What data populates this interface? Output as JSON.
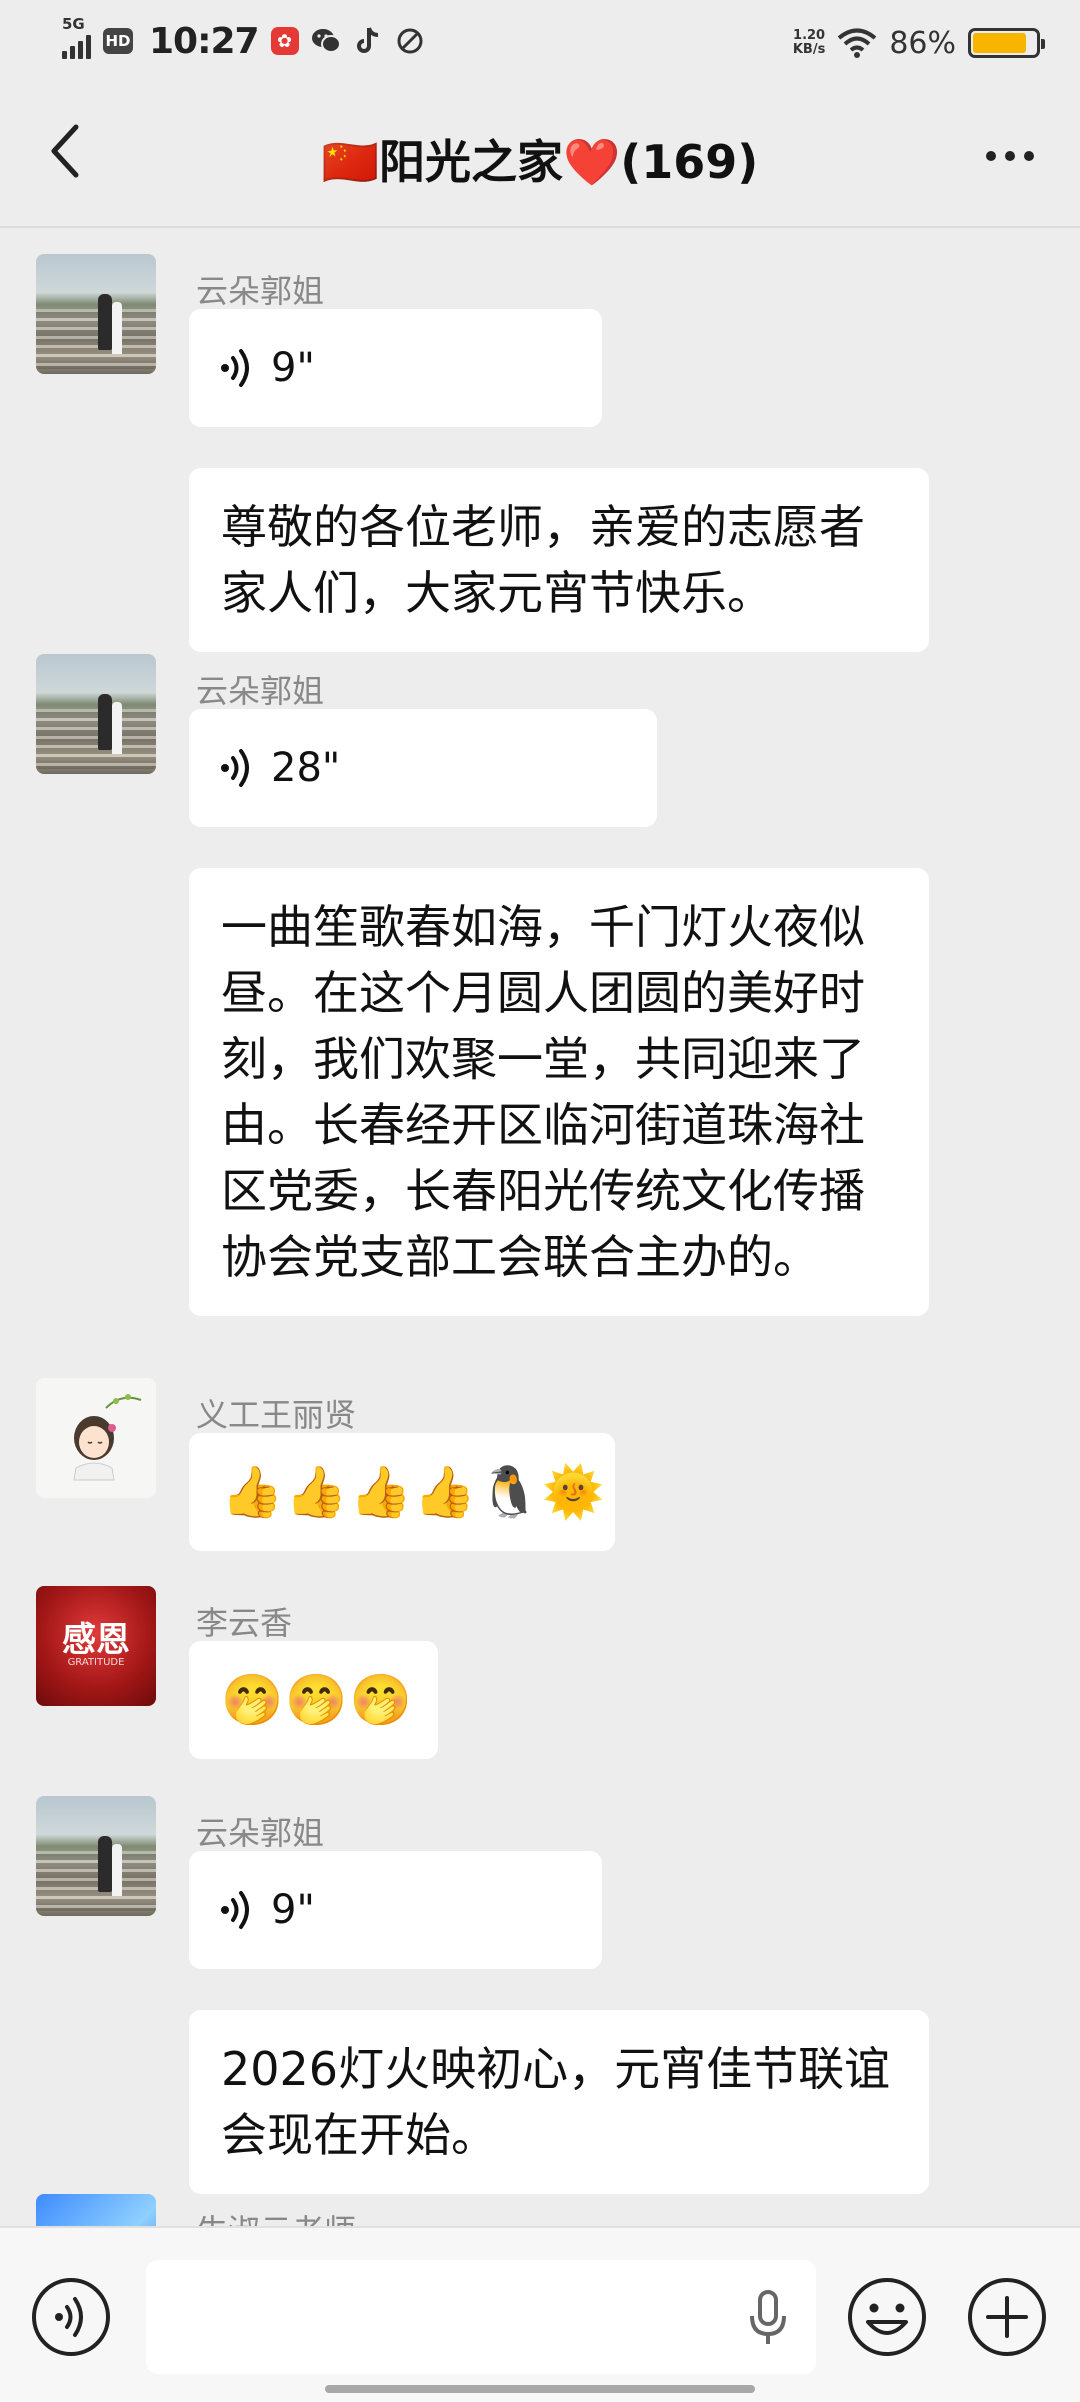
{
  "status_bar": {
    "network": "5G",
    "hd": "HD",
    "time": "10:27",
    "net_speed_value": "1.20",
    "net_speed_unit": "KB/s",
    "battery_percent": "86%",
    "battery_level": 0.86
  },
  "header": {
    "title": "🇨🇳阳光之家❤️(169)"
  },
  "messages": [
    {
      "sender": "云朵郭姐",
      "voice_duration": "9\"",
      "text": "尊敬的各位老师，亲爱的志愿者家人们，大家元宵节快乐。"
    },
    {
      "sender": "云朵郭姐",
      "voice_duration": "28\"",
      "text": "一曲笙歌春如海，千门灯火夜似昼。在这个月圆人团圆的美好时刻，我们欢聚一堂，共同迎来了由。长春经开区临河街道珠海社区党委，长春阳光传统文化传播协会党支部工会联合主办的。"
    },
    {
      "sender": "义工王丽贤",
      "emoji": "👍👍👍👍🐧🌞"
    },
    {
      "sender": "李云香",
      "emoji": "🤭🤭🤭",
      "avatar_text": "感恩",
      "avatar_subtext": "GRATITUDE"
    },
    {
      "sender": "云朵郭姐",
      "voice_duration": "9\"",
      "text": "2026灯火映初心，元宵佳节联谊会现在开始。"
    },
    {
      "sender": "牛淑云老师"
    }
  ],
  "colors": {
    "background": "#ededed",
    "bubble": "#ffffff",
    "sender_name": "#888888",
    "battery_fill": "#f7b500"
  },
  "icons": {
    "back": "chevron-left-icon",
    "more": "more-dots-icon",
    "voice": "voice-wave-icon",
    "mic": "microphone-icon",
    "emoji": "smiley-icon",
    "plus": "plus-icon"
  }
}
